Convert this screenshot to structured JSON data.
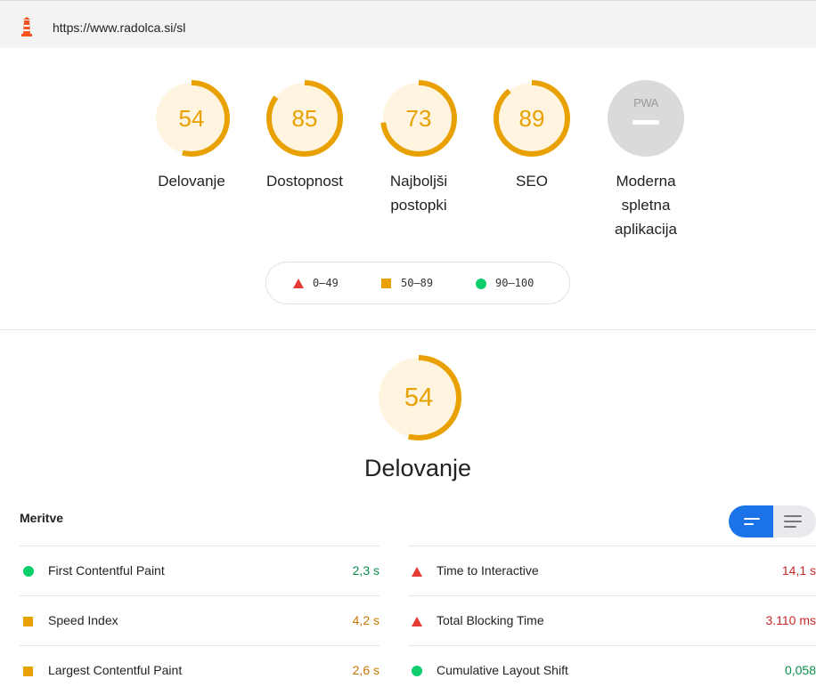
{
  "address_bar": {
    "url": "https://www.radolca.si/sl",
    "icon": "lighthouse-icon"
  },
  "colors": {
    "average": "#e8a100",
    "pass": "#0cce6b",
    "fail": "#e53935",
    "gauge_bg": "#fff4e0",
    "pwa_gray": "#dadada",
    "toggle_blue": "#1a73e8"
  },
  "categories": [
    {
      "score": "54",
      "label": "Delovanje",
      "fraction": 0.54
    },
    {
      "score": "85",
      "label": "Dostopnost",
      "fraction": 0.85
    },
    {
      "score": "73",
      "label": "Najboljši postopki",
      "fraction": 0.73
    },
    {
      "score": "89",
      "label": "SEO",
      "fraction": 0.89
    },
    {
      "label": "Moderna spletna aplikacija",
      "badge": "PWA"
    }
  ],
  "legend": [
    {
      "range": "0–49",
      "shape": "triangle-fail-icon"
    },
    {
      "range": "50–89",
      "shape": "square-average-icon"
    },
    {
      "range": "90–100",
      "shape": "circle-pass-icon"
    }
  ],
  "performance": {
    "score": "54",
    "fraction": 0.54,
    "title": "Delovanje"
  },
  "metrics": {
    "title": "Meritve",
    "left": [
      {
        "name": "First Contentful Paint",
        "value": "2,3 s",
        "status": "pass"
      },
      {
        "name": "Speed Index",
        "value": "4,2 s",
        "status": "average"
      },
      {
        "name": "Largest Contentful Paint",
        "value": "2,6 s",
        "status": "average"
      }
    ],
    "right": [
      {
        "name": "Time to Interactive",
        "value": "14,1 s",
        "status": "fail"
      },
      {
        "name": "Total Blocking Time",
        "value": "3.110 ms",
        "status": "fail"
      },
      {
        "name": "Cumulative Layout Shift",
        "value": "0,058",
        "status": "pass"
      }
    ]
  }
}
